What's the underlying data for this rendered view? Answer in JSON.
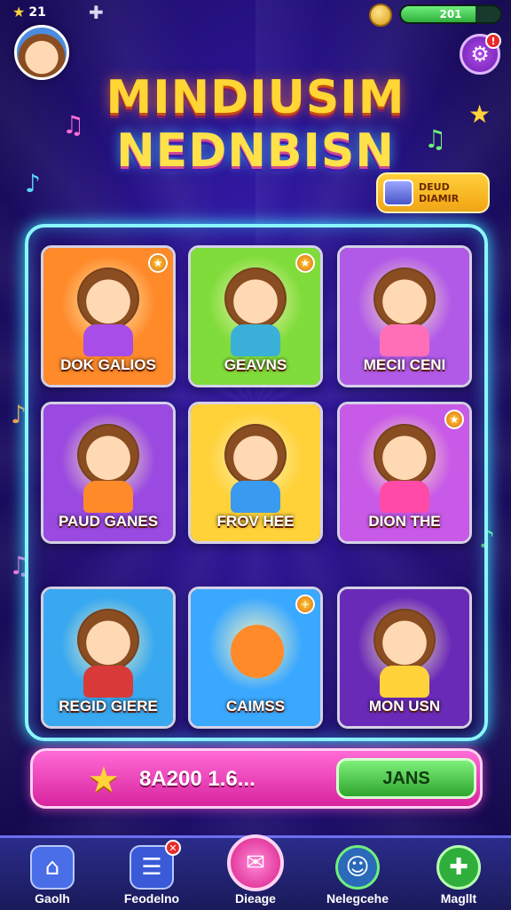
{
  "top": {
    "stars_count": "21",
    "energy_value": "201",
    "energy_level": 0.75
  },
  "title": {
    "line1": "MINDIUSIM",
    "line2": "NEDNBISN"
  },
  "daily": {
    "label_line1": "DEUD",
    "label_line2": "DIAMIR"
  },
  "cards": [
    {
      "label": "DOK GALIOS",
      "bg": "#ff8a2a",
      "body": "#a84de8"
    },
    {
      "label": "GEAVNS",
      "bg": "#7fdc3a",
      "body": "#3ab0d8"
    },
    {
      "label": "MECII CENI",
      "bg": "#b25ae8",
      "body": "#ff6fb8"
    },
    {
      "label": "PAUD GANES",
      "bg": "#9a4ae0",
      "body": "#ff8a2a"
    },
    {
      "label": "FROV HEE",
      "bg": "#ffd23a",
      "body": "#3a9af0"
    },
    {
      "label": "DION THE",
      "bg": "#c85ae8",
      "body": "#ff4aa8"
    },
    {
      "label": "REGID GIERE",
      "bg": "#38a8f0",
      "body": "#d83a3a"
    },
    {
      "label": "CAIMSS",
      "bg": "#3aa8ff",
      "body": "#ff8a2a"
    },
    {
      "label": "MON USN",
      "bg": "#6a2ab8",
      "body": "#ffd23a"
    }
  ],
  "progress": {
    "text": "8A200 1.6...",
    "button_label": "JANS"
  },
  "nav": [
    {
      "label": "Gaolh",
      "icon": "home-icon"
    },
    {
      "label": "Feodelno",
      "icon": "list-icon"
    },
    {
      "label": "Dieage",
      "icon": "mail-icon"
    },
    {
      "label": "Nelegcehe",
      "icon": "chat-icon"
    },
    {
      "label": "Magllt",
      "icon": "plus-icon"
    }
  ],
  "colors": {
    "accent": "#8af7ff",
    "title_yellow": "#ffd633",
    "progress_pink": "#d8249e",
    "join_green": "#2fa52e"
  }
}
